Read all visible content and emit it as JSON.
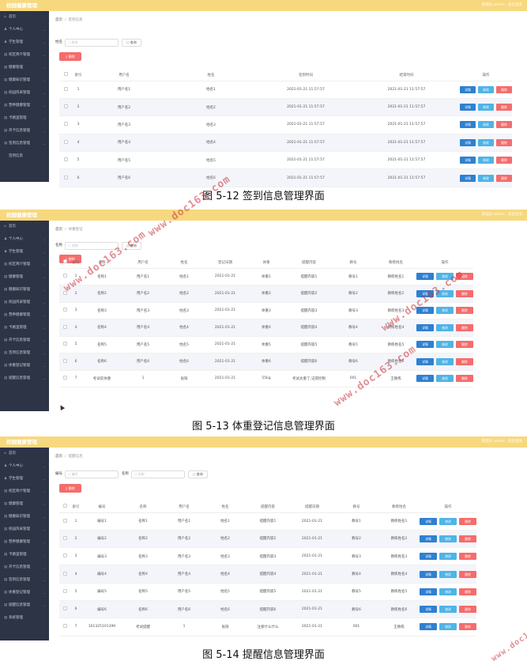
{
  "brand": "校园健康管理",
  "topright": "管理员 admin · 退出登录",
  "sidebar_arrow": "⌄",
  "watermark": "www.doc163.com",
  "search_label": "查询",
  "delete_label": "删除",
  "ops": {
    "detail": "详情",
    "edit": "修改",
    "del": "删除"
  },
  "panels": [
    {
      "caption": "图 5-12 签到信息管理界面",
      "crumb_home": "首页",
      "crumb_cur": "签到信息",
      "sidebar": [
        {
          "icon": "⌂",
          "label": "首页",
          "arrow": false
        },
        {
          "icon": "♟",
          "label": "个人中心",
          "arrow": true
        },
        {
          "icon": "♟",
          "label": "学生管理",
          "arrow": true
        },
        {
          "icon": "▤",
          "label": "校区简介管理",
          "arrow": true
        },
        {
          "icon": "▤",
          "label": "健康管理",
          "arrow": true
        },
        {
          "icon": "▤",
          "label": "健康知识管理",
          "arrow": true
        },
        {
          "icon": "▤",
          "label": "校园风采管理",
          "arrow": true
        },
        {
          "icon": "▤",
          "label": "营养健康管理",
          "arrow": true
        },
        {
          "icon": "▤",
          "label": "卡路里管理",
          "arrow": true
        },
        {
          "icon": "▤",
          "label": "开卡信息管理",
          "arrow": true
        },
        {
          "icon": "▤",
          "label": "签到信息管理",
          "arrow": true
        },
        {
          "icon": "",
          "label": "签到信息",
          "arrow": false
        }
      ],
      "filters": [
        {
          "label": "姓名",
          "placeholder": "姓名"
        }
      ],
      "columns": [
        "",
        "索引",
        "用户名",
        "姓名",
        "签到时间",
        "结束时间",
        "操作"
      ],
      "rows": [
        [
          "1",
          "用户名1",
          "姓名1",
          "2021-01-21 11:57:57",
          "2021-01-21 11:57:57"
        ],
        [
          "2",
          "用户名2",
          "姓名2",
          "2021-01-21 11:57:57",
          "2021-01-21 11:57:57"
        ],
        [
          "3",
          "用户名3",
          "姓名3",
          "2021-01-21 11:57:57",
          "2021-01-21 11:57:57"
        ],
        [
          "4",
          "用户名4",
          "姓名4",
          "2021-01-21 11:57:57",
          "2021-01-21 11:57:57"
        ],
        [
          "5",
          "用户名5",
          "姓名5",
          "2021-01-21 11:57:57",
          "2021-01-21 11:57:57"
        ],
        [
          "6",
          "用户名6",
          "姓名6",
          "2021-01-21 11:57:57",
          "2021-01-21 11:57:57"
        ]
      ]
    },
    {
      "caption": "图 5-13 体重登记信息管理界面",
      "crumb_home": "首页",
      "crumb_cur": "体重登记",
      "sidebar": [
        {
          "icon": "⌂",
          "label": "首页",
          "arrow": false
        },
        {
          "icon": "♟",
          "label": "个人中心",
          "arrow": true
        },
        {
          "icon": "♟",
          "label": "学生管理",
          "arrow": true
        },
        {
          "icon": "▤",
          "label": "校区简介管理",
          "arrow": true
        },
        {
          "icon": "▤",
          "label": "健康管理",
          "arrow": true
        },
        {
          "icon": "▤",
          "label": "健康知识管理",
          "arrow": true
        },
        {
          "icon": "▤",
          "label": "校园风采管理",
          "arrow": true
        },
        {
          "icon": "▤",
          "label": "营养健康管理",
          "arrow": true
        },
        {
          "icon": "▤",
          "label": "卡路里管理",
          "arrow": true
        },
        {
          "icon": "▤",
          "label": "开卡信息管理",
          "arrow": true
        },
        {
          "icon": "▤",
          "label": "签到信息管理",
          "arrow": true
        },
        {
          "icon": "▤",
          "label": "体重登记管理",
          "arrow": true
        },
        {
          "icon": "▤",
          "label": "提醒信息管理",
          "arrow": true
        }
      ],
      "filters": [
        {
          "label": "名称",
          "placeholder": "名称"
        }
      ],
      "columns": [
        "",
        "索引",
        "名称",
        "用户名",
        "姓名",
        "登记日期",
        "体重",
        "提醒内容",
        "教号",
        "教练姓名",
        "操作"
      ],
      "rows": [
        [
          "1",
          "名称1",
          "用户名1",
          "姓名1",
          "2021-01-21",
          "体重1",
          "提醒内容1",
          "教号1",
          "教练姓名1"
        ],
        [
          "2",
          "名称2",
          "用户名2",
          "姓名2",
          "2021-01-21",
          "体重2",
          "提醒内容2",
          "教号2",
          "教练姓名2"
        ],
        [
          "3",
          "名称3",
          "用户名3",
          "姓名3",
          "2021-01-21",
          "体重3",
          "提醒内容3",
          "教号3",
          "教练姓名3"
        ],
        [
          "4",
          "名称4",
          "用户名4",
          "姓名4",
          "2021-01-21",
          "体重4",
          "提醒内容4",
          "教号4",
          "教练姓名4"
        ],
        [
          "5",
          "名称5",
          "用户名5",
          "姓名5",
          "2021-01-21",
          "体重5",
          "提醒内容5",
          "教号5",
          "教练姓名5"
        ],
        [
          "6",
          "名称6",
          "用户名6",
          "姓名6",
          "2021-01-21",
          "体重6",
          "提醒内容6",
          "教号6",
          "教练姓名6"
        ],
        [
          "7",
          "考试前体重",
          "1",
          "张阳",
          "2021-01-21",
          "55kg",
          "考试太重了,记得控制",
          "001",
          "王教练"
        ]
      ]
    },
    {
      "caption": "图 5-14 提醒信息管理界面",
      "crumb_home": "首页",
      "crumb_cur": "提醒信息",
      "sidebar": [
        {
          "icon": "⌂",
          "label": "首页",
          "arrow": false
        },
        {
          "icon": "♟",
          "label": "个人中心",
          "arrow": true
        },
        {
          "icon": "♟",
          "label": "学生管理",
          "arrow": true
        },
        {
          "icon": "▤",
          "label": "校区简介管理",
          "arrow": true
        },
        {
          "icon": "▤",
          "label": "健康管理",
          "arrow": true
        },
        {
          "icon": "▤",
          "label": "健康知识管理",
          "arrow": true
        },
        {
          "icon": "▤",
          "label": "校园风采管理",
          "arrow": true
        },
        {
          "icon": "▤",
          "label": "营养健康管理",
          "arrow": true
        },
        {
          "icon": "▤",
          "label": "卡路里管理",
          "arrow": true
        },
        {
          "icon": "▤",
          "label": "开卡信息管理",
          "arrow": true
        },
        {
          "icon": "▤",
          "label": "签到信息管理",
          "arrow": true
        },
        {
          "icon": "▤",
          "label": "体重登记管理",
          "arrow": true
        },
        {
          "icon": "▤",
          "label": "提醒信息管理",
          "arrow": true
        },
        {
          "icon": "▤",
          "label": "系统管理",
          "arrow": false
        }
      ],
      "filters": [
        {
          "label": "编号",
          "placeholder": "编号"
        },
        {
          "label": "名称",
          "placeholder": "名称"
        }
      ],
      "columns": [
        "",
        "索引",
        "编号",
        "名称",
        "用户名",
        "姓名",
        "提醒内容",
        "提醒日期",
        "教号",
        "教练姓名",
        "操作"
      ],
      "rows": [
        [
          "1",
          "编号1",
          "名称1",
          "用户名1",
          "姓名1",
          "提醒内容1",
          "2021-01-21",
          "教号1",
          "教练姓名1"
        ],
        [
          "2",
          "编号2",
          "名称2",
          "用户名2",
          "姓名2",
          "提醒内容2",
          "2021-01-21",
          "教号2",
          "教练姓名2"
        ],
        [
          "3",
          "编号3",
          "名称3",
          "用户名3",
          "姓名3",
          "提醒内容3",
          "2021-01-21",
          "教号3",
          "教练姓名3"
        ],
        [
          "4",
          "编号4",
          "名称4",
          "用户名4",
          "姓名4",
          "提醒内容4",
          "2021-01-21",
          "教号4",
          "教练姓名4"
        ],
        [
          "5",
          "编号5",
          "名称5",
          "用户名5",
          "姓名5",
          "提醒内容5",
          "2021-01-21",
          "教号5",
          "教练姓名5"
        ],
        [
          "6",
          "编号6",
          "名称6",
          "用户名6",
          "姓名6",
          "提醒内容6",
          "2021-01-21",
          "教号6",
          "教练姓名6"
        ],
        [
          "7",
          "161325101399",
          "考试提醒",
          "1",
          "张阳",
          "注意什么什么",
          "2021-01-21",
          "001",
          "王教练"
        ]
      ]
    }
  ]
}
